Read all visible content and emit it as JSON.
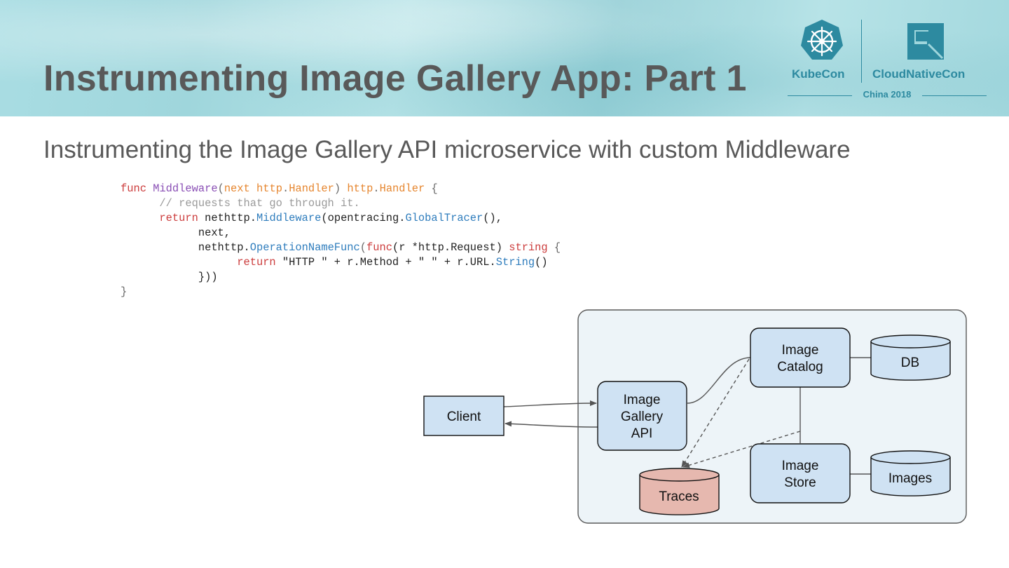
{
  "slide": {
    "title": "Instrumenting Image Gallery App: Part 1",
    "subtitle": "Instrumenting the Image Gallery API microservice with custom Middleware"
  },
  "logo": {
    "left_text": "KubeCon",
    "right_text": "CloudNativeCon",
    "event": "China 2018"
  },
  "code": {
    "l1": {
      "kw_func": "func",
      "name": "Middleware",
      "open": "(",
      "param": "next",
      "pkg1": "http",
      "dot1": ".",
      "type1": "Handler",
      "close": ")",
      "pkg2": "http",
      "dot2": ".",
      "type2": "Handler",
      "brace": "{"
    },
    "l2": {
      "comment": "// requests that go through it."
    },
    "l3": {
      "kw_return": "return",
      "obj": "nethttp",
      "dot": ".",
      "method": "Middleware",
      "open": "(opentracing.",
      "method2": "GlobalTracer",
      "close": "(),"
    },
    "l4": {
      "text": "next,"
    },
    "l5": {
      "obj": "nethttp.",
      "method": "OperationNameFunc",
      "open": "(",
      "kw_func": "func",
      "args": "(r *http.Request)",
      "kw_type": "string",
      "brace": "{"
    },
    "l6": {
      "kw_return": "return",
      "expr": "\"HTTP \" + r.Method + \" \" + r.URL.",
      "method": "String",
      "close": "()"
    },
    "l7": {
      "text": "}))"
    },
    "l8": {
      "text": "}"
    }
  },
  "diagram": {
    "client": "Client",
    "gallery_api": [
      "Image",
      "Gallery",
      "API"
    ],
    "catalog": [
      "Image",
      "Catalog"
    ],
    "store": [
      "Image",
      "Store"
    ],
    "db": "DB",
    "images": "Images",
    "traces": "Traces"
  },
  "colors": {
    "header_bg": "#a9dde3",
    "title_text": "#595959",
    "brand_teal": "#2d8aa0",
    "service_box": "#cfe2f3",
    "traces_fill": "#e6b8af",
    "cluster_bg": "#edf4f8"
  }
}
